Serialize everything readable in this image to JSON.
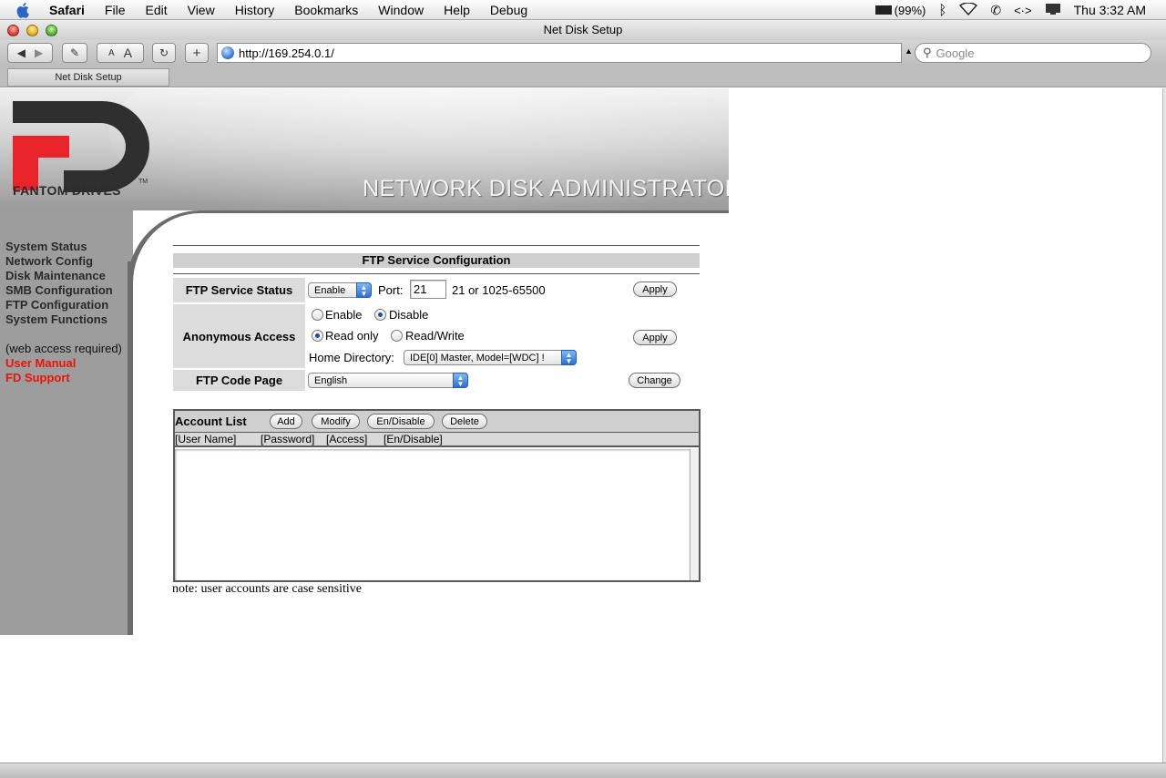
{
  "menubar": {
    "app": "Safari",
    "items": [
      "File",
      "Edit",
      "View",
      "History",
      "Bookmarks",
      "Window",
      "Help",
      "Debug"
    ],
    "battery": "(99%)",
    "clock": "Thu 3:32 AM"
  },
  "window": {
    "title": "Net Disk Setup"
  },
  "browser": {
    "url": "http://169.254.0.1/",
    "search_placeholder": "Google",
    "text_smaller": "A",
    "text_bigger": "A",
    "tab_title": "Net Disk Setup"
  },
  "banner": {
    "title": "NETWORK DISK ADMINISTRATOR",
    "logo_text": "FANTOM DRIVES",
    "logo_mark": "FD"
  },
  "nav": {
    "items": [
      "System Status",
      "Network Config",
      "Disk Maintenance",
      "SMB Configuration",
      "FTP Configuration",
      "System Functions"
    ],
    "note": "(web access required)",
    "links": [
      "User Manual",
      "FD Support"
    ]
  },
  "ftp": {
    "section_title": "FTP Service Configuration",
    "service_status": {
      "label": "FTP Service Status",
      "value": "Enable",
      "port_label": "Port:",
      "port_value": "21",
      "port_hint": "21 or 1025-65500",
      "apply": "Apply"
    },
    "anonymous": {
      "label": "Anonymous Access",
      "enable": "Enable",
      "disable": "Disable",
      "enabled": false,
      "read_only": "Read only",
      "read_write": "Read/Write",
      "mode": "read_only",
      "home_label": "Home Directory:",
      "home_value": "IDE[0] Master, Model=[WDC] !",
      "apply": "Apply"
    },
    "code_page": {
      "label": "FTP Code Page",
      "value": "English",
      "change": "Change"
    }
  },
  "accounts": {
    "title": "Account List",
    "buttons": [
      "Add",
      "Modify",
      "En/Disable",
      "Delete"
    ],
    "columns": [
      "[User Name]",
      "[Password]",
      "[Access]",
      "[En/Disable]"
    ],
    "rows": [],
    "note": "note: user accounts are case sensitive"
  }
}
